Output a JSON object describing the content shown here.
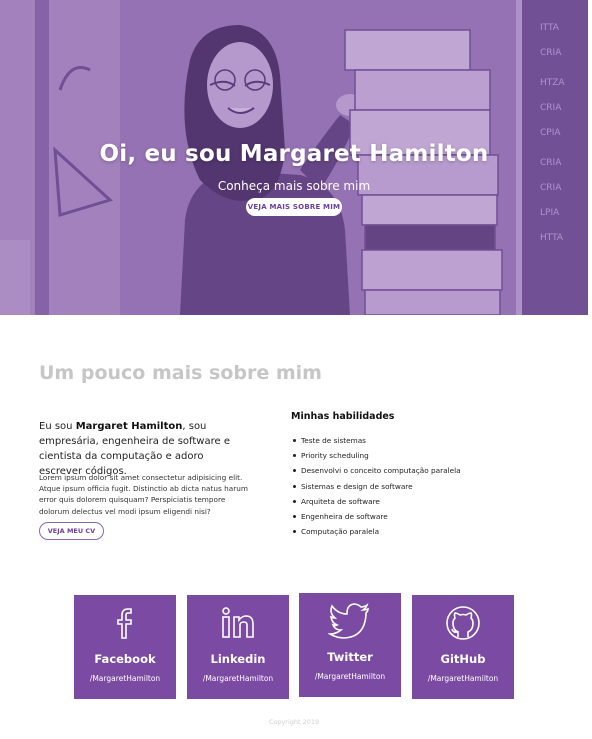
{
  "hero": {
    "title": "Oi, eu sou Margaret Hamilton",
    "subtitle": "Conheça mais sobre mim",
    "button_label": "VEJA MAIS SOBRE MIM"
  },
  "about": {
    "title": "Um pouco mais sobre mim",
    "intro_prefix": "Eu sou ",
    "intro_name": "Margaret Hamilton",
    "intro_suffix": ", sou empresária, engenheira de software e cientista da computação e adoro escrever códigos.",
    "lorem": "Lorem ipsum dolor sit amet consectetur adipisicing elit. Atque ipsum officia fugit. Distinctio ab dicta natus harum error quis dolorem quisquam? Perspiciatis tempore dolorum delectus vel modi ipsum eligendi nisi?",
    "cv_button_label": "VEJA MEU CV"
  },
  "skills": {
    "title": "Minhas habilidades",
    "items": [
      "Teste de sistemas",
      "Priority scheduling",
      "Desenvolvi o conceito computação paralela",
      "Sistemas e design de software",
      "Arquiteta de software",
      "Engenheira de software",
      "Computação paralela"
    ]
  },
  "social": [
    {
      "name": "Facebook",
      "handle": "/MargaretHamilton",
      "icon": "facebook-icon"
    },
    {
      "name": "Linkedin",
      "handle": "/MargaretHamilton",
      "icon": "linkedin-icon"
    },
    {
      "name": "Twitter",
      "handle": "/MargaretHamilton",
      "icon": "twitter-icon"
    },
    {
      "name": "GitHub",
      "handle": "/MargaretHamilton",
      "icon": "github-icon"
    }
  ],
  "footer": {
    "copyright": "Copyright 2019"
  },
  "colors": {
    "accent": "#7b4aa3",
    "hero_tint": "#8a6aa6",
    "muted_title": "#c6c6c6"
  }
}
